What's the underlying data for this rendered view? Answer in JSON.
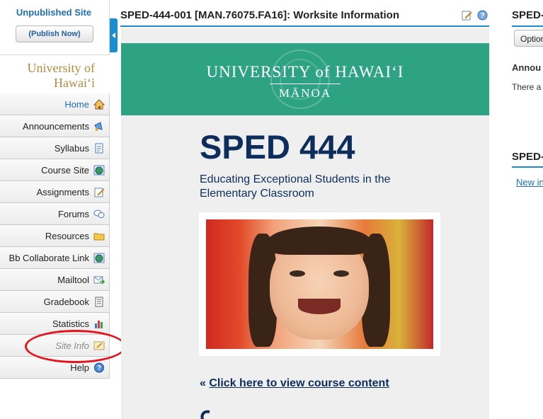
{
  "sidebar": {
    "status_title": "Unpublished Site",
    "publish_button": "(Publish Now)",
    "logo_text_line1": "University of",
    "logo_text_line2": "Hawaiʻi",
    "items": [
      {
        "label": "Home",
        "icon": "home-icon",
        "state": "current"
      },
      {
        "label": "Announcements",
        "icon": "megaphone-icon",
        "state": "normal"
      },
      {
        "label": "Syllabus",
        "icon": "document-icon",
        "state": "normal"
      },
      {
        "label": "Course Site",
        "icon": "globe-icon",
        "state": "normal"
      },
      {
        "label": "Assignments",
        "icon": "pencil-document-icon",
        "state": "normal"
      },
      {
        "label": "Forums",
        "icon": "speech-bubbles-icon",
        "state": "normal"
      },
      {
        "label": "Resources",
        "icon": "folder-icon",
        "state": "normal"
      },
      {
        "label": "Bb Collaborate Link",
        "icon": "globe-icon",
        "state": "normal"
      },
      {
        "label": "Mailtool",
        "icon": "mail-arrow-icon",
        "state": "normal"
      },
      {
        "label": "Gradebook",
        "icon": "gradebook-icon",
        "state": "normal"
      },
      {
        "label": "Statistics",
        "icon": "bar-chart-icon",
        "state": "normal"
      },
      {
        "label": "Site Info",
        "icon": "site-info-icon",
        "state": "dim"
      },
      {
        "label": "Help",
        "icon": "help-icon",
        "state": "normal"
      }
    ]
  },
  "main": {
    "title": "SPED-444-001 [MAN.76075.FA16]: Worksite Information",
    "banner": {
      "university": "UNIVERSITY of HAWAIʻI",
      "campus": "MĀNOA"
    },
    "course_code": "SPED 444",
    "course_name": "Educating Exceptional Students in the Elementary Classroom",
    "link_prefix": "«",
    "link_text": "Click here to view course content"
  },
  "right": {
    "title1": "SPED-",
    "options_button": "Option",
    "announcements_heading": "Annou",
    "announcements_text": "There a",
    "title2": "SPED-",
    "new_link": "New in"
  },
  "colors": {
    "accent_blue": "#1a8ed1",
    "banner_green": "#2ea384",
    "course_navy": "#0d2e5c",
    "annotation_red": "#e3141b"
  }
}
